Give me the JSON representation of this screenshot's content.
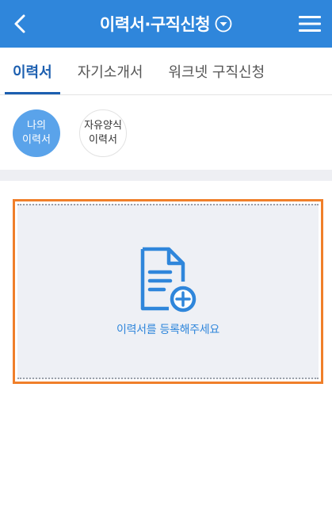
{
  "header": {
    "title": "이력서·구직신청",
    "back_icon": "chevron-left-icon",
    "dropdown_icon": "circle-chevron-down-icon",
    "menu_icon": "hamburger-menu-icon",
    "background_color": "#2f86db"
  },
  "tabs": [
    {
      "label": "이력서",
      "active": true
    },
    {
      "label": "자기소개서",
      "active": false
    },
    {
      "label": "워크넷 구직신청",
      "active": false
    }
  ],
  "chips": [
    {
      "label_line1": "나의",
      "label_line2": "이력서",
      "active": true
    },
    {
      "label_line1": "자유양식",
      "label_line2": "이력서",
      "active": false
    }
  ],
  "upload": {
    "icon": "document-add-icon",
    "text": "이력서를 등록해주세요",
    "accent_color": "#2f86db",
    "highlight_border_color": "#f07f2a"
  }
}
